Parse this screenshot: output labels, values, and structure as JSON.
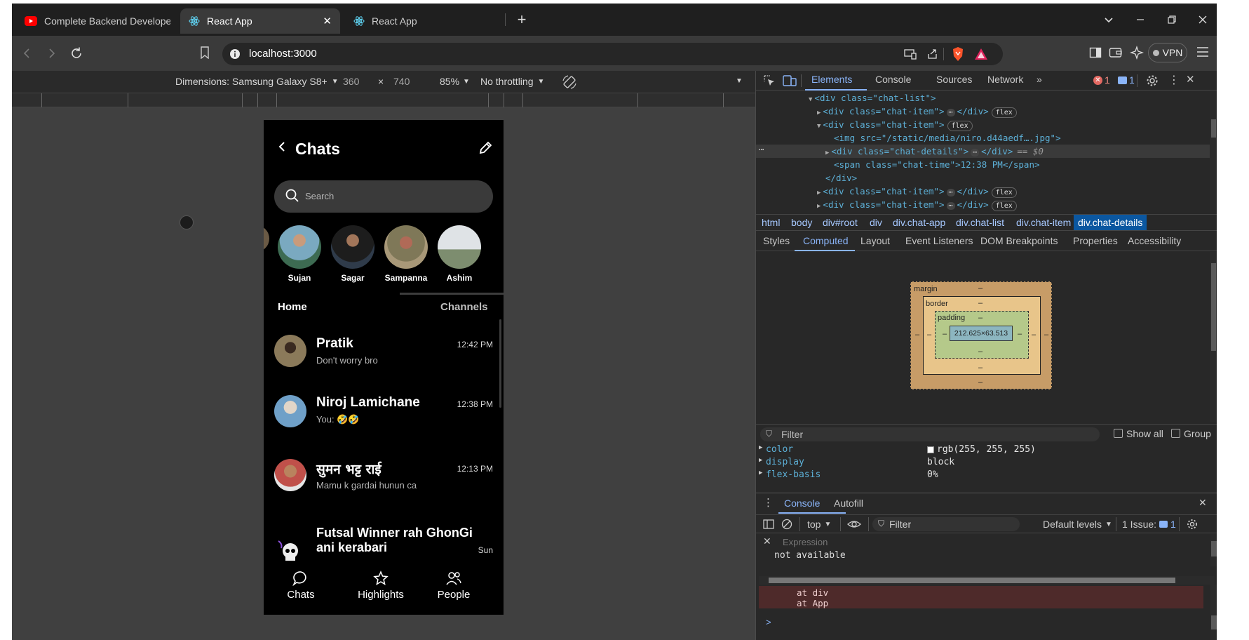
{
  "browser": {
    "tabs": [
      {
        "title": "Complete Backend Developer cours",
        "icon": "youtube-icon",
        "active": false
      },
      {
        "title": "React App",
        "icon": "react-icon",
        "active": true
      },
      {
        "title": "React App",
        "icon": "react-icon",
        "active": false
      }
    ],
    "url": "localhost:3000",
    "vpn_label": "VPN"
  },
  "device_toolbar": {
    "device": "Dimensions: Samsung Galaxy S8+",
    "width": "360",
    "times": "×",
    "height": "740",
    "zoom": "85%",
    "throttling": "No throttling"
  },
  "app": {
    "header": {
      "title": "Chats"
    },
    "search": {
      "placeholder": "Search"
    },
    "stories": [
      {
        "name": "Sujan"
      },
      {
        "name": "Sagar"
      },
      {
        "name": "Sampanna"
      },
      {
        "name": "Ashim"
      }
    ],
    "sections": {
      "home": "Home",
      "channels": "Channels"
    },
    "chats": [
      {
        "name": "Pratik",
        "message": "Don't worry bro",
        "time": "12:42 PM"
      },
      {
        "name": "Niroj Lamichane",
        "message": "You: 🤣🤣",
        "time": "12:38 PM"
      },
      {
        "name": "सुमन भट्ट राई",
        "message": "Mamu k gardai hunun ca",
        "time": "12:13 PM"
      },
      {
        "name": "Futsal Winner rah GhonGi ani kerabari",
        "message": "",
        "time": "Sun"
      }
    ],
    "bottom_nav": [
      {
        "label": "Chats",
        "icon": "chat-bubble-icon"
      },
      {
        "label": "Highlights",
        "icon": "star-icon"
      },
      {
        "label": "People",
        "icon": "people-icon"
      }
    ]
  },
  "devtools": {
    "tabs": [
      "Elements",
      "Console",
      "Sources",
      "Network"
    ],
    "error_count": "1",
    "message_count": "1",
    "elements": {
      "lines": [
        {
          "indent": 0,
          "arrow": "▼",
          "html": "<div class=\"chat-list\">"
        },
        {
          "indent": 1,
          "arrow": "▶",
          "html": "<div class=\"chat-item\">",
          "collapsed": true,
          "flex": true
        },
        {
          "indent": 1,
          "arrow": "▼",
          "html": "<div class=\"chat-item\">",
          "flex": true
        },
        {
          "indent": 2,
          "arrow": "",
          "html": "<img src=\"/static/media/niro.d44aedf….jpg\">"
        },
        {
          "indent": 2,
          "arrow": "▶",
          "html": "<div class=\"chat-details\">",
          "collapsed": true,
          "selected": true,
          "suffix": "== $0"
        },
        {
          "indent": 2,
          "arrow": "",
          "html": "<span class=\"chat-time\">12:38 PM</span>"
        },
        {
          "indent": 1,
          "arrow": "",
          "html": "</div>"
        },
        {
          "indent": 1,
          "arrow": "▶",
          "html": "<div class=\"chat-item\">",
          "collapsed": true,
          "flex": true
        },
        {
          "indent": 1,
          "arrow": "▶",
          "html": "<div class=\"chat-item\">",
          "collapsed": true,
          "flex": true
        }
      ]
    },
    "breadcrumbs": [
      "html",
      "body",
      "div#root",
      "div",
      "div.chat-app",
      "div.chat-list",
      "div.chat-item",
      "div.chat-details"
    ],
    "subtabs": [
      "Styles",
      "Computed",
      "Layout",
      "Event Listeners",
      "DOM Breakpoints",
      "Properties",
      "Accessibility"
    ],
    "box_model": {
      "margin": "margin",
      "border": "border",
      "padding": "padding",
      "dash": "–",
      "content": "212.625×63.513"
    },
    "computed_filter": {
      "placeholder": "Filter",
      "show_all": "Show all",
      "group": "Group"
    },
    "computed_props": [
      {
        "name": "color",
        "value": "rgb(255, 255, 255)"
      },
      {
        "name": "display",
        "value": "block"
      },
      {
        "name": "flex-basis",
        "value": "0%"
      }
    ],
    "drawer": {
      "tabs": [
        "Console",
        "Autofill"
      ],
      "context": "top",
      "filter_placeholder": "Filter",
      "levels": "Default levels",
      "issues": "1 Issue:",
      "issues_count": "1",
      "expression_placeholder": "Expression",
      "expression_result": "not available",
      "error_lines": [
        "at div",
        "at App"
      ],
      "prompt": ">"
    }
  },
  "colors": {
    "accent": "#8ab4f8",
    "error": "#f28b82",
    "selected_crumb": "#0b57a0",
    "phone_bg": "#000000",
    "search_bg": "#3a3a3a"
  }
}
